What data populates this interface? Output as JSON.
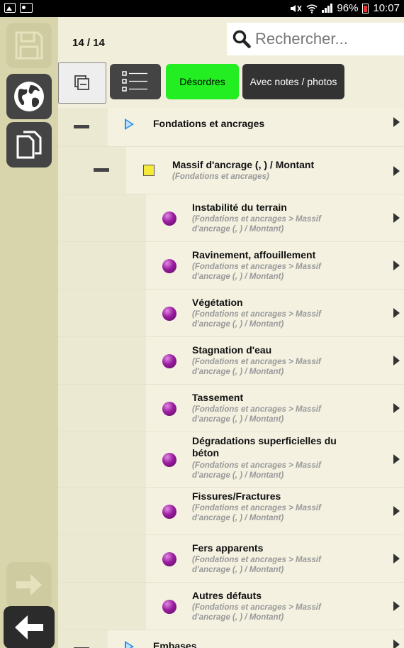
{
  "status_bar": {
    "battery": "96%",
    "time": "10:07"
  },
  "header": {
    "counter": "14 / 14",
    "search_placeholder": "Rechercher..."
  },
  "filters": {
    "desordres_label": "Désordres",
    "notes_label": "Avec notes / photos"
  },
  "tree": {
    "category": {
      "label": "Fondations et ancrages"
    },
    "element": {
      "label": "Massif d'ancrage (, ) / Montant",
      "path": "(Fondations et ancrages)"
    },
    "items": [
      {
        "label": "Instabilité du terrain",
        "path": "(Fondations et ancrages > Massif d'ancrage (, ) / Montant)"
      },
      {
        "label": "Ravinement, affouillement",
        "path": "(Fondations et ancrages > Massif d'ancrage (, ) / Montant)"
      },
      {
        "label": "Végétation",
        "path": "(Fondations et ancrages > Massif d'ancrage (, ) / Montant)"
      },
      {
        "label": "Stagnation d'eau",
        "path": "(Fondations et ancrages > Massif d'ancrage (, ) / Montant)"
      },
      {
        "label": "Tassement",
        "path": "(Fondations et ancrages > Massif d'ancrage (, ) / Montant)"
      },
      {
        "label": "Dégradations superficielles du béton",
        "path": "(Fondations et ancrages > Massif d'ancrage (, ) / Montant)"
      },
      {
        "label": "Fissures/Fractures",
        "path": "(Fondations et ancrages > Massif d'ancrage (, ) / Montant)"
      },
      {
        "label": "Fers apparents",
        "path": "(Fondations et ancrages > Massif d'ancrage (, ) / Montant)"
      },
      {
        "label": "Autres défauts",
        "path": "(Fondations et ancrages > Massif d'ancrage (, ) / Montant)"
      }
    ],
    "next_category": {
      "label": "Embases"
    }
  },
  "colors": {
    "accent_green": "#22ee22",
    "rail_bg": "#d8d5ac",
    "dot_purple": "#9b1da0"
  },
  "icons": [
    "save-icon",
    "globe-icon",
    "copy-icon",
    "forward-arrow-icon",
    "back-arrow-icon",
    "search-icon",
    "collapse-icon",
    "list-icon"
  ]
}
